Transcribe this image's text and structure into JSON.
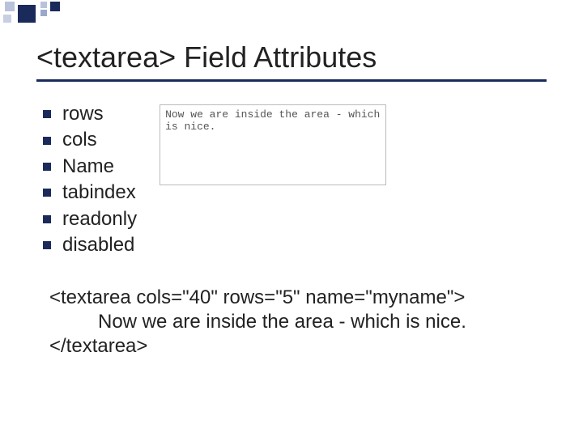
{
  "title": "<textarea> Field Attributes",
  "bullets": [
    "rows",
    "cols",
    "Name",
    "tabindex",
    "readonly",
    "disabled"
  ],
  "textarea_value": "Now we are inside the area - which is nice.",
  "code": {
    "open_tag": "<textarea cols=\"40\" rows=\"5\" name=\"myname\">",
    "inner": "Now we are inside the area - which is nice.",
    "close_tag": "</textarea>"
  }
}
